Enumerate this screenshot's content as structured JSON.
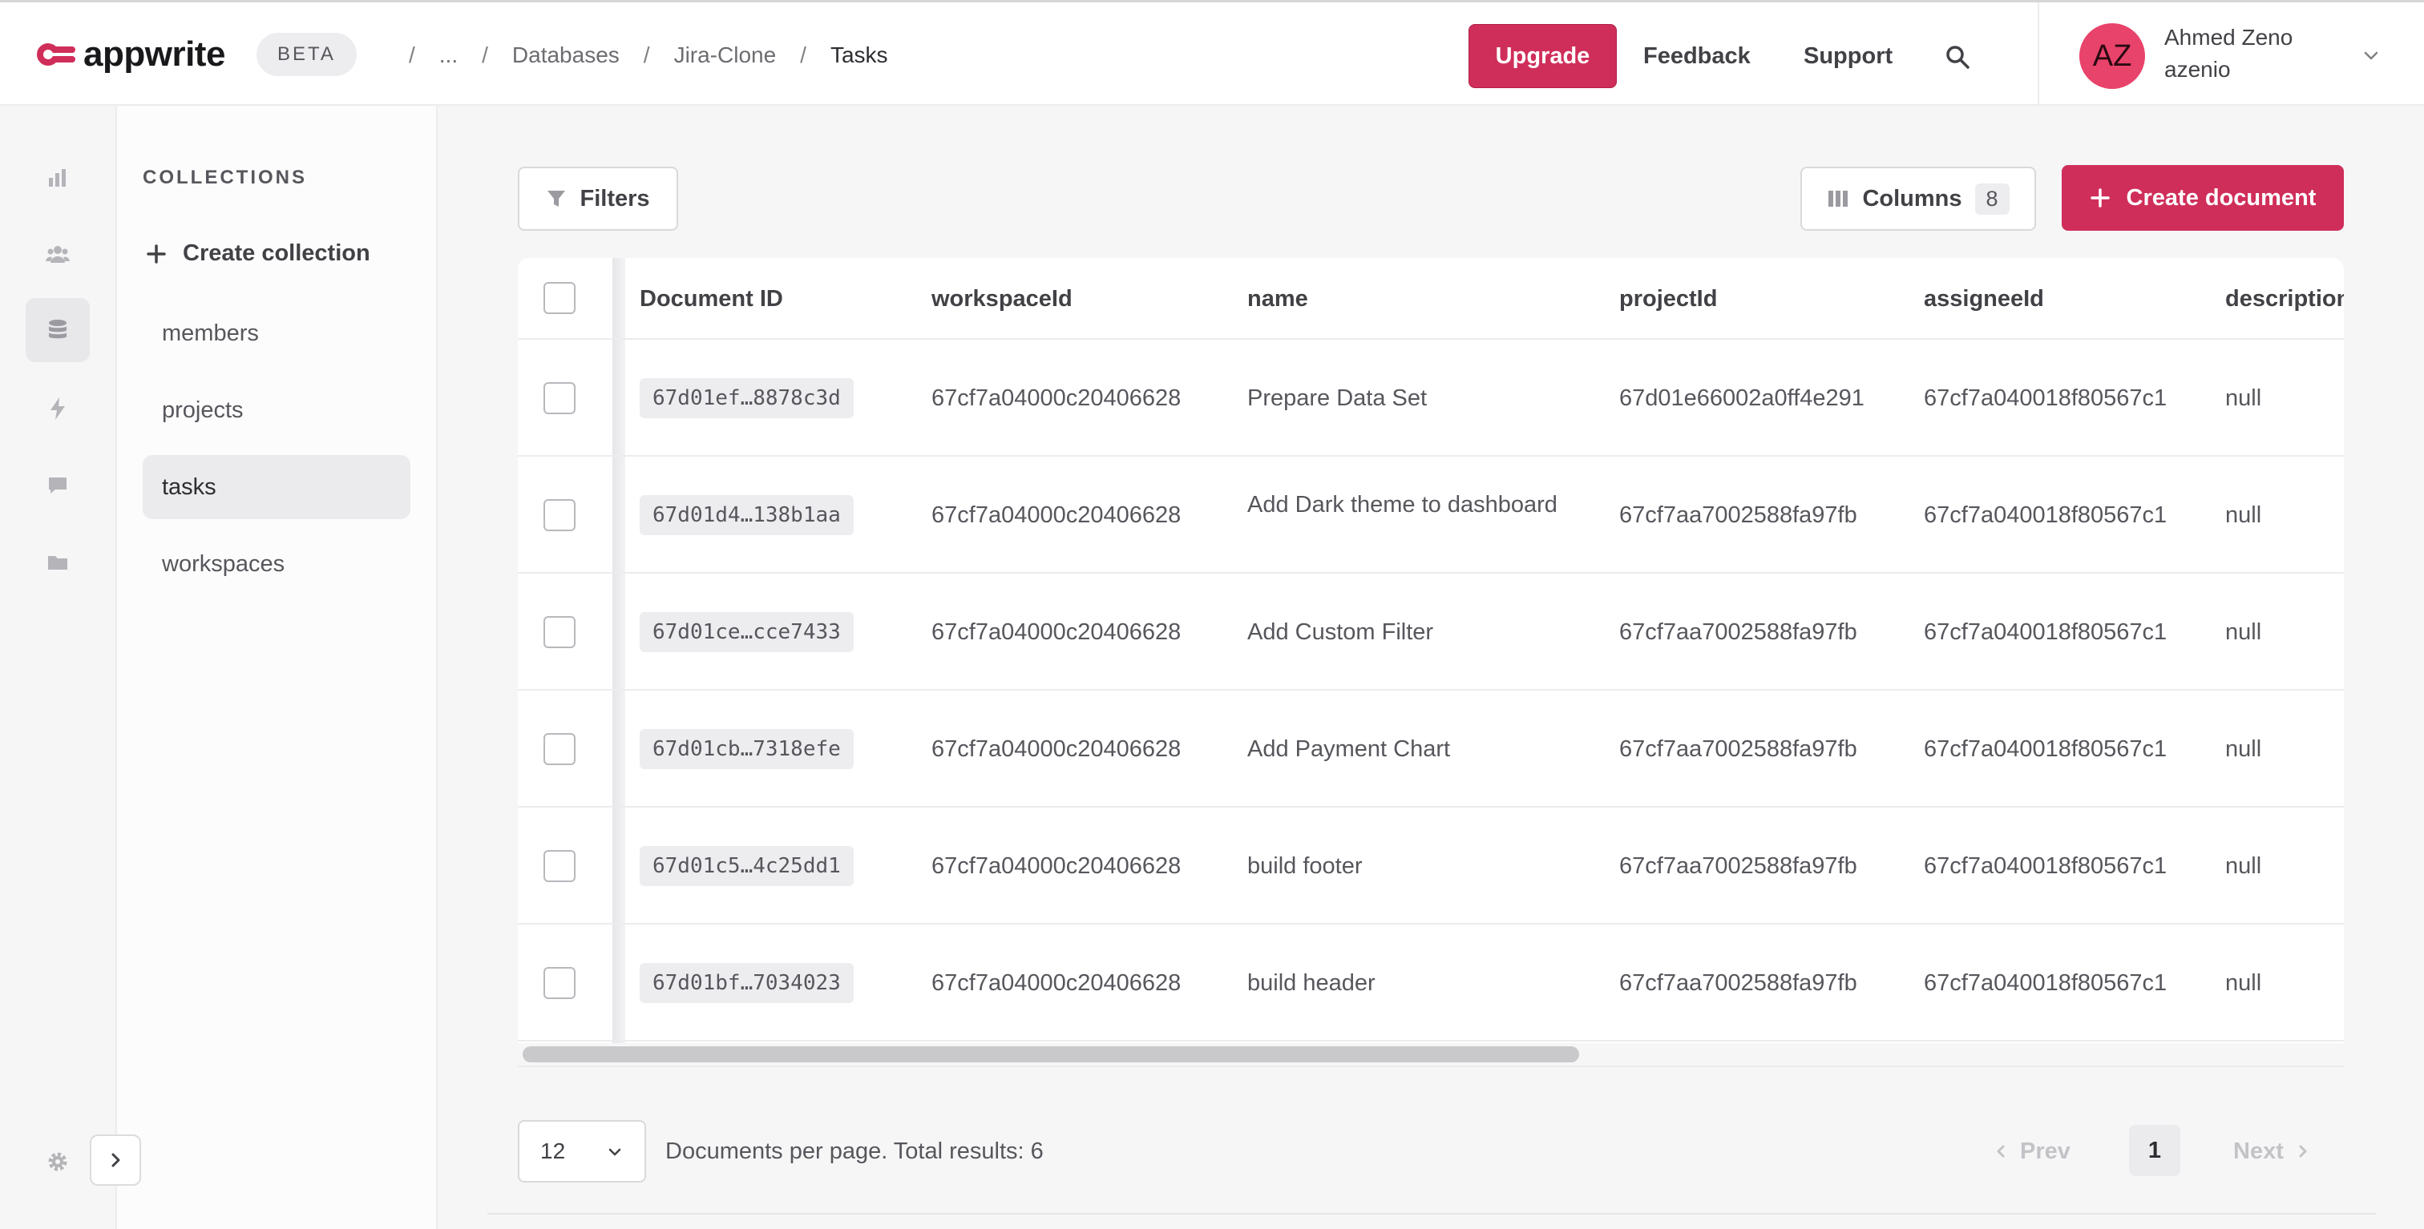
{
  "header": {
    "logo_text": "appwrite",
    "beta_label": "BETA",
    "breadcrumbs": [
      "...",
      "Databases",
      "Jira-Clone",
      "Tasks"
    ],
    "upgrade_label": "Upgrade",
    "feedback_label": "Feedback",
    "support_label": "Support",
    "user": {
      "initials": "AZ",
      "name": "Ahmed Zeno",
      "org": "azenio"
    },
    "accent_color": "#d02e5a"
  },
  "rail": {
    "icons": [
      "overview-icon",
      "auth-icon",
      "databases-icon",
      "functions-icon",
      "messaging-icon",
      "storage-icon"
    ],
    "settings_icon": "gear-icon"
  },
  "collections": {
    "heading": "COLLECTIONS",
    "create_label": "Create collection",
    "items": [
      "members",
      "projects",
      "tasks",
      "workspaces"
    ],
    "active": "tasks"
  },
  "toolbar": {
    "filters_label": "Filters",
    "columns_label": "Columns",
    "columns_count": "8",
    "create_label": "Create document"
  },
  "table": {
    "columns": [
      "Document ID",
      "workspaceId",
      "name",
      "projectId",
      "assigneeId",
      "description"
    ],
    "rows": [
      {
        "id": "67d01ef…8878c3d",
        "workspaceId": "67cf7a04000c20406628",
        "name": "Prepare Data Set",
        "projectId": "67d01e66002a0ff4e291",
        "assigneeId": "67cf7a040018f80567c1",
        "description": "null"
      },
      {
        "id": "67d01d4…138b1aa",
        "workspaceId": "67cf7a04000c20406628",
        "name": "Add Dark theme to dashboard",
        "projectId": "67cf7aa7002588fa97fb",
        "assigneeId": "67cf7a040018f80567c1",
        "description": "null"
      },
      {
        "id": "67d01ce…cce7433",
        "workspaceId": "67cf7a04000c20406628",
        "name": "Add Custom Filter",
        "projectId": "67cf7aa7002588fa97fb",
        "assigneeId": "67cf7a040018f80567c1",
        "description": "null"
      },
      {
        "id": "67d01cb…7318efe",
        "workspaceId": "67cf7a04000c20406628",
        "name": "Add Payment Chart",
        "projectId": "67cf7aa7002588fa97fb",
        "assigneeId": "67cf7a040018f80567c1",
        "description": "null"
      },
      {
        "id": "67d01c5…4c25dd1",
        "workspaceId": "67cf7a04000c20406628",
        "name": "build footer",
        "projectId": "67cf7aa7002588fa97fb",
        "assigneeId": "67cf7a040018f80567c1",
        "description": "null"
      },
      {
        "id": "67d01bf…7034023",
        "workspaceId": "67cf7a04000c20406628",
        "name": "build header",
        "projectId": "67cf7aa7002588fa97fb",
        "assigneeId": "67cf7a040018f80567c1",
        "description": "null"
      }
    ]
  },
  "pagination": {
    "per_page": "12",
    "summary": "Documents per page. Total results: 6",
    "prev_label": "Prev",
    "current_page": "1",
    "next_label": "Next"
  }
}
